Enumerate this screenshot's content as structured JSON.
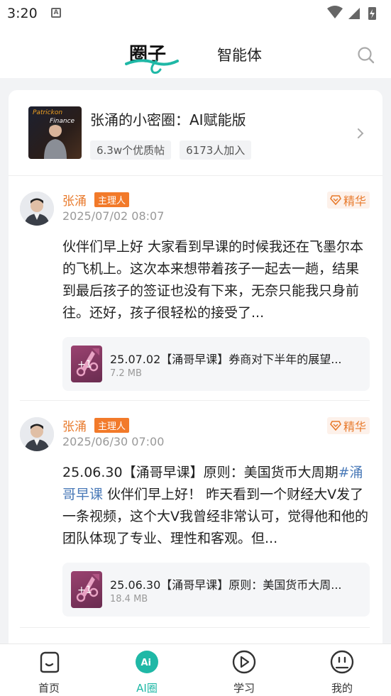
{
  "status_bar": {
    "time": "3:20"
  },
  "header": {
    "tabs": [
      {
        "label": "圈子",
        "active": true
      },
      {
        "label": "智能体",
        "active": false
      }
    ]
  },
  "circle": {
    "title": "张涌的小密圈：AI赋能版",
    "cover_text": [
      "Patrickon",
      "Finance"
    ],
    "tags": [
      "6.3w个优质帖",
      "6173人加入"
    ]
  },
  "posts": [
    {
      "author": "张涌",
      "role": "主理人",
      "time": "2025/07/02 08:07",
      "badge": "精华",
      "text_before": "伙伴们早上好 大家看到早课的时候我还在飞墨尔本的飞机上。这次本来想带着孩子一起去一趟，结果到最后孩子的签证也没有下来，无奈只能我只身前往。还好，孩子很轻松的接受了...",
      "tag": "",
      "text_after": "",
      "attachment": {
        "name": "25.07.02【涌哥早课】券商对下半年的展望...",
        "size": "7.2 MB",
        "badge": "+1"
      }
    },
    {
      "author": "张涌",
      "role": "主理人",
      "time": "2025/06/30 07:00",
      "badge": "精华",
      "text_before": "25.06.30【涌哥早课】原则：美国货币大周期",
      "tag": "#涌哥早课",
      "text_after": " 伙伴们早上好！ 昨天看到一个财经大V发了一条视频，这个大V我曾经非常认可，觉得他和他的团队体现了专业、理性和客观。但...",
      "attachment": {
        "name": "25.06.30【涌哥早课】原则：美国货币大周...",
        "size": "18.4 MB",
        "badge": "+1"
      }
    }
  ],
  "bottom_nav": [
    {
      "label": "首页",
      "icon": "home-icon",
      "active": false
    },
    {
      "label": "AI圈",
      "icon": "ai-icon",
      "active": true
    },
    {
      "label": "学习",
      "icon": "play-icon",
      "active": false
    },
    {
      "label": "我的",
      "icon": "face-icon",
      "active": false
    }
  ],
  "colors": {
    "accent": "#1fb8a6",
    "author": "#e87a2c",
    "role_badge": "#f27a2a",
    "hashtag": "#4a7ab8"
  }
}
